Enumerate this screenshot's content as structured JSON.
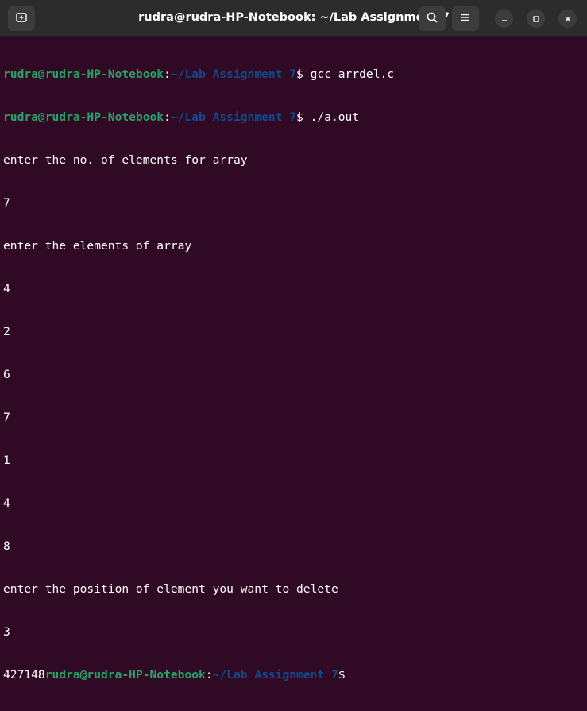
{
  "window": {
    "title": "rudra@rudra-HP-Notebook: ~/Lab Assignment 7"
  },
  "icons": {
    "new_tab": "new-tab-icon",
    "search": "search-icon",
    "menu": "hamburger-menu-icon",
    "minimize": "minimize-icon",
    "maximize": "maximize-icon",
    "close": "close-icon"
  },
  "colors": {
    "background": "#300a24",
    "titlebar": "#2c2c2c",
    "prompt_user": "#26a269",
    "prompt_path": "#12488b",
    "text": "#ffffff"
  },
  "terminal": {
    "prompt1": {
      "user": "rudra@rudra-HP-Notebook",
      "sep": ":",
      "path": "~/Lab Assignment 7",
      "sym": "$ ",
      "cmd": "gcc arrdel.c"
    },
    "prompt2": {
      "user": "rudra@rudra-HP-Notebook",
      "sep": ":",
      "path": "~/Lab Assignment 7",
      "sym": "$ ",
      "cmd": "./a.out"
    },
    "output": [
      "enter the no. of elements for array",
      "7",
      "enter the elements of array",
      "4",
      "2",
      "6",
      "7",
      "1",
      "4",
      "8",
      "enter the position of element you want to delete",
      "3"
    ],
    "final": {
      "out": "427148",
      "user": "rudra@rudra-HP-Notebook",
      "sep": ":",
      "path": "~/Lab Assignment 7",
      "sym": "$"
    }
  }
}
